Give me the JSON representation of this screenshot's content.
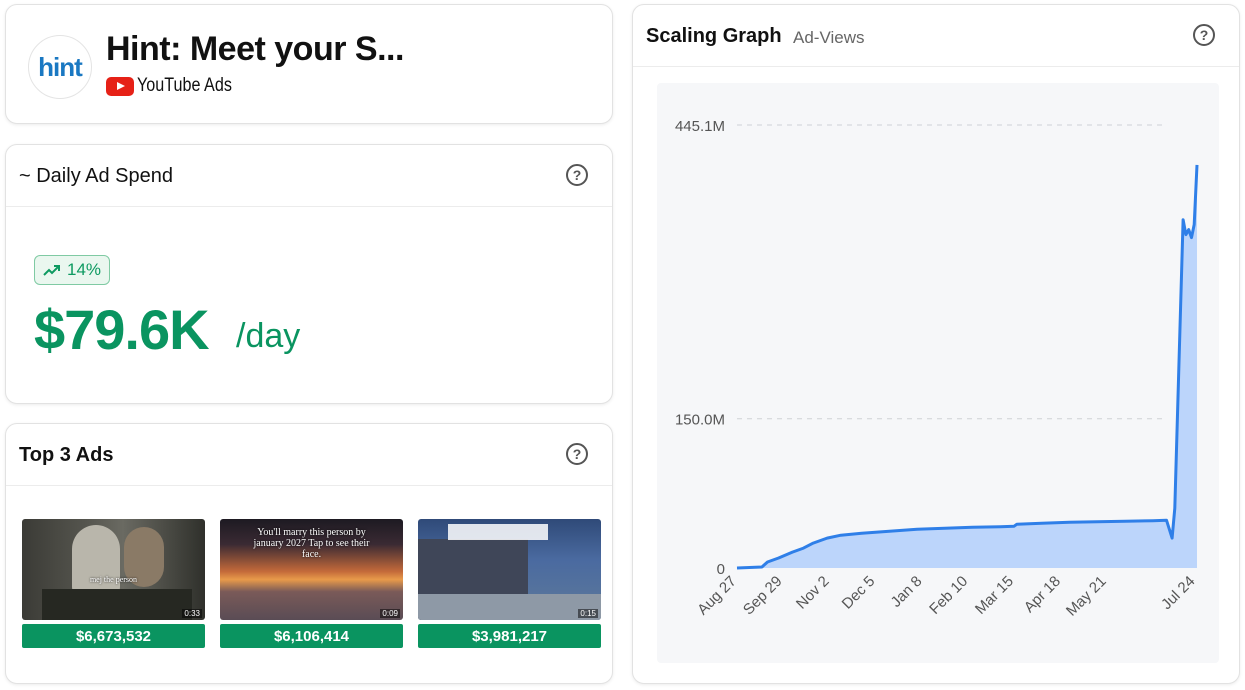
{
  "brand": {
    "logo_text": "hint",
    "title": "Hint: Meet your S...",
    "platform": "YouTube Ads"
  },
  "spend": {
    "title": "~ Daily Ad Spend",
    "trend": "14%",
    "value": "$79.6K",
    "unit": "/day",
    "color": "#0a9460"
  },
  "top_ads": {
    "title": "Top 3 Ads",
    "ads": [
      {
        "caption": "mej the person",
        "duration": "0:33",
        "spend": "$6,673,532"
      },
      {
        "caption": "You'll marry this person by january 2027 Tap to see their face.",
        "duration": "0:09",
        "spend": "$6,106,414"
      },
      {
        "caption": "",
        "duration": "0:15",
        "spend": "$3,981,217"
      }
    ]
  },
  "graph": {
    "title": "Scaling Graph",
    "subtitle": "Ad-Views"
  },
  "icons": {
    "help": "help-circle-icon",
    "trend": "trending-up-icon",
    "youtube": "youtube-icon"
  },
  "chart_data": {
    "type": "area",
    "y_tick_labels": [
      "445.1M",
      "150.0M",
      "0"
    ],
    "y_ticks": [
      445.1,
      150.0,
      0
    ],
    "ylim": [
      0,
      445.1
    ],
    "x_tick_labels": [
      "Aug 27",
      "Sep 29",
      "Nov 2",
      "Dec 5",
      "Jan 8",
      "Feb 10",
      "Mar 15",
      "Apr 18",
      "May 21",
      "Jul 24"
    ],
    "x_tick_index": [
      0,
      33,
      67,
      100,
      134,
      167,
      200,
      234,
      267,
      331
    ],
    "series": [
      {
        "x": [
          0,
          18,
          22,
          30,
          40,
          48,
          55,
          65,
          75,
          90,
          110,
          130,
          150,
          170,
          190,
          200,
          202,
          220,
          240,
          260,
          280,
          300,
          310,
          314,
          316,
          322,
          324,
          326,
          328,
          330,
          332
        ],
        "y": [
          0,
          1,
          6,
          10,
          16,
          20,
          25,
          30,
          33,
          35,
          37,
          39,
          40,
          41,
          41.5,
          42,
          44,
          45,
          46,
          46.5,
          47,
          47.5,
          48,
          30,
          60,
          350,
          335,
          340,
          332,
          345,
          405
        ]
      }
    ],
    "line_color": "#2f7fe8",
    "fill_color": "#bcd5fb",
    "grid": true
  }
}
